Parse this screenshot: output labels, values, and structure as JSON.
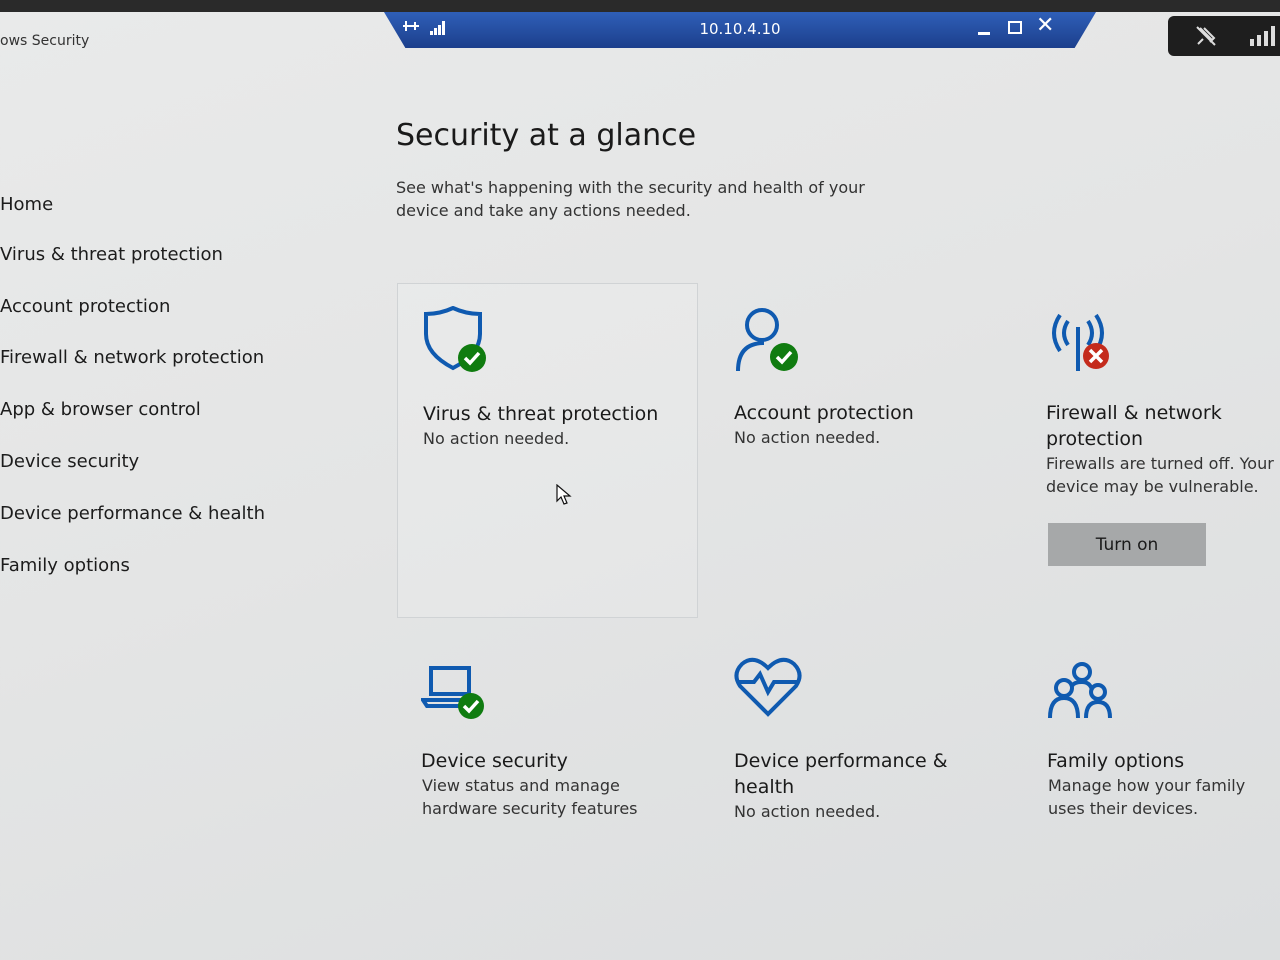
{
  "window": {
    "title": "ows Security"
  },
  "remote_bar": {
    "host": "10.10.4.10"
  },
  "nav": {
    "items": [
      {
        "label": "Home"
      },
      {
        "label": "Virus & threat protection"
      },
      {
        "label": "Account protection"
      },
      {
        "label": "Firewall & network protection"
      },
      {
        "label": "App & browser control"
      },
      {
        "label": "Device security"
      },
      {
        "label": "Device performance & health"
      },
      {
        "label": "Family options"
      }
    ]
  },
  "main": {
    "title": "Security at a glance",
    "description": "See what's happening with the security and health of your device and take any actions needed.",
    "tiles": [
      {
        "icon": "shield-check-icon",
        "title": "Virus & threat protection",
        "status": "No action needed."
      },
      {
        "icon": "person-check-icon",
        "title": "Account protection",
        "status": "No action needed."
      },
      {
        "icon": "wireless-error-icon",
        "title": "Firewall & network protection",
        "status": "Firewalls are turned off. Your device may be vulnerable.",
        "action": "Turn on"
      },
      {
        "icon": "laptop-check-icon",
        "title": "Device security",
        "status": "View status and manage hardware security features"
      },
      {
        "icon": "heart-pulse-icon",
        "title": "Device performance & health",
        "status": "No action needed."
      },
      {
        "icon": "family-icon",
        "title": "Family options",
        "status": "Manage how your family uses their devices."
      }
    ]
  },
  "colors": {
    "accent": "#0f5ab0",
    "ok": "#107c10",
    "error": "#c42b1c",
    "remote_bar": "#234b9e"
  }
}
